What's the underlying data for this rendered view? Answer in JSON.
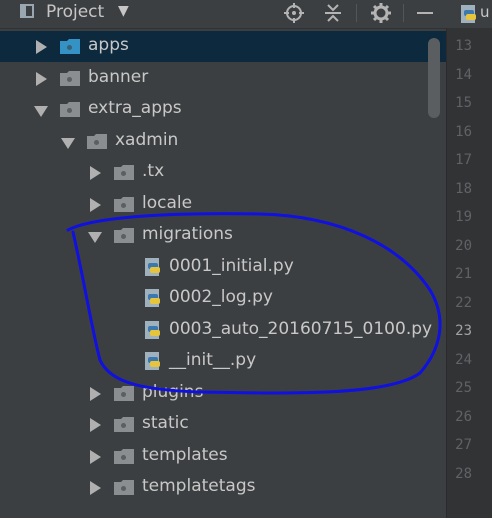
{
  "header": {
    "title": "Project",
    "caret": "▼",
    "tools": [
      "locate-target-icon",
      "collapse-all-icon",
      "gear-icon",
      "hide-icon"
    ]
  },
  "tree": [
    {
      "label": "apps",
      "type": "folder",
      "state": "collapsed",
      "depth": 0,
      "selected": true,
      "folder_color": "#3592c4"
    },
    {
      "label": "banner",
      "type": "folder",
      "state": "collapsed",
      "depth": 0
    },
    {
      "label": "extra_apps",
      "type": "folder",
      "state": "expanded",
      "depth": 0
    },
    {
      "label": "xadmin",
      "type": "folder",
      "state": "expanded",
      "depth": 1
    },
    {
      "label": ".tx",
      "type": "folder",
      "state": "collapsed",
      "depth": 2
    },
    {
      "label": "locale",
      "type": "folder",
      "state": "collapsed",
      "depth": 2
    },
    {
      "label": "migrations",
      "type": "folder",
      "state": "expanded",
      "depth": 2
    },
    {
      "label": "0001_initial.py",
      "type": "python-file",
      "depth": 3
    },
    {
      "label": "0002_log.py",
      "type": "python-file",
      "depth": 3
    },
    {
      "label": "0003_auto_20160715_0100.py",
      "type": "python-file",
      "depth": 3
    },
    {
      "label": "__init__.py",
      "type": "python-file",
      "depth": 3
    },
    {
      "label": "plugins",
      "type": "folder",
      "state": "collapsed",
      "depth": 2
    },
    {
      "label": "static",
      "type": "folder",
      "state": "collapsed",
      "depth": 2
    },
    {
      "label": "templates",
      "type": "folder",
      "state": "collapsed",
      "depth": 2
    },
    {
      "label": "templatetags",
      "type": "folder",
      "state": "collapsed",
      "depth": 2
    }
  ],
  "editor": {
    "tab_label": "u",
    "line_numbers": [
      "13",
      "14",
      "15",
      "16",
      "17",
      "18",
      "19",
      "20",
      "21",
      "22",
      "23",
      "24",
      "25",
      "26",
      "27",
      "28"
    ],
    "current_line": "23"
  },
  "colors": {
    "panel_bg": "#3c3f41",
    "selection_bg": "#0d293e",
    "annotation_stroke": "#1010e0"
  }
}
